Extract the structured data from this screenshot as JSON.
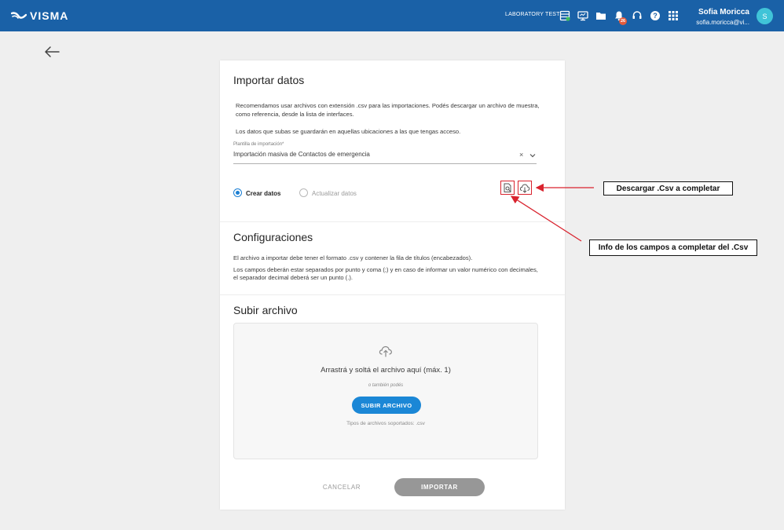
{
  "header": {
    "brand": "VISMA",
    "environment": "LABORATORY TEST",
    "icons": [
      "spreadsheet-icon",
      "monitor-icon",
      "folder-icon",
      "bell-icon",
      "headset-icon",
      "help-icon",
      "apps-grid-icon"
    ],
    "notification_count": "26",
    "user_name": "Sofia Moricca",
    "user_email": "sofia.moricca@vi...",
    "avatar_initial": "S",
    "bar_color": "#1a61a7"
  },
  "import": {
    "title": "Importar datos",
    "description": "Recomendamos usar archivos con extensión .csv para las importaciones. Podés descargar un archivo de muestra, como referencia, desde la lista de interfaces.",
    "access_note": "Los datos que subas se guardarán en aquellas ubicaciones a las que tengas acceso.",
    "template_label": "Plantilla de importación*",
    "template_value": "Importación masiva de Contactos de emergencia",
    "radio_create": "Crear datos",
    "radio_update": "Actualizar datos",
    "selected_mode": "Crear datos"
  },
  "config": {
    "title": "Configuraciones",
    "line1": "El archivo a importar debe tener el formato .csv y contener la fila de títulos (encabezados).",
    "line2": "Los campos deberán estar separados por punto y coma (;) y en caso de informar un valor numérico con decimales, el separador decimal deberá ser un punto (.)."
  },
  "upload": {
    "title": "Subir archivo",
    "drop_text": "Arrastrá y soltá el archivo aquí (máx. 1)",
    "or_text": "o también podés",
    "button": "SUBIR ARCHIVO",
    "types": "Tipos de archivos soportados: .csv"
  },
  "actions": {
    "cancel": "CANCELAR",
    "import": "IMPORTAR"
  },
  "annotations": {
    "download_csv": "Descargar .Csv a completar",
    "fields_info": "Info de los campos a completar del .Csv",
    "color": "#d9232e"
  }
}
